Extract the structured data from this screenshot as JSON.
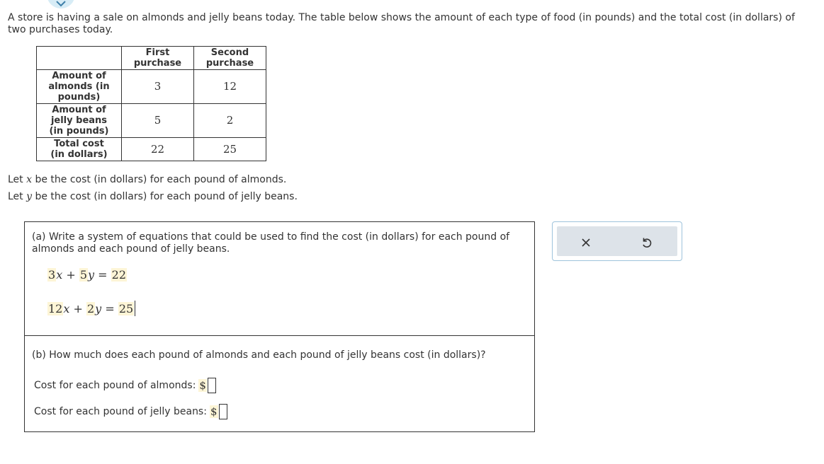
{
  "intro": "A store is having a sale on almonds and jelly beans today. The table below shows the amount of each type of food (in pounds) and the total cost (in dollars) of two purchases today.",
  "table": {
    "col_headers": [
      "First purchase",
      "Second purchase"
    ],
    "rows": [
      {
        "label": "Amount of almonds (in pounds)",
        "values": [
          "3",
          "12"
        ]
      },
      {
        "label": "Amount of jelly beans (in pounds)",
        "values": [
          "5",
          "2"
        ]
      },
      {
        "label": "Total cost (in dollars)",
        "values": [
          "22",
          "25"
        ]
      }
    ]
  },
  "let_x": {
    "prefix": "Let",
    "var": "x",
    "text": "be the cost (in dollars) for each pound of almonds."
  },
  "let_y": {
    "prefix": "Let",
    "var": "y",
    "text": "be the cost (in dollars) for each pound of jelly beans."
  },
  "part_a": {
    "question": "(a) Write a system of equations that could be used to find the cost (in dollars) for each pound of almonds and each pound of jelly beans.",
    "eq1": {
      "c1": "3",
      "v1": "x",
      "op": "+",
      "c2": "5",
      "v2": "y",
      "eqsign": "=",
      "rhs": "22"
    },
    "eq2": {
      "c1": "12",
      "v1": "x",
      "op": "+",
      "c2": "2",
      "v2": "y",
      "eqsign": "=",
      "rhs": "25"
    }
  },
  "part_b": {
    "question": "(b) How much does each pound of almonds and each pound of jelly beans cost (in dollars)?",
    "almonds_label": "Cost for each pound of almonds:",
    "jelly_label": "Cost for each pound of jelly beans:",
    "currency": "$",
    "almonds_value": "",
    "jelly_value": ""
  },
  "tools": {
    "clear_icon": "close-icon",
    "undo_icon": "undo-icon"
  },
  "colors": {
    "highlight": "#fdf5d6",
    "tool_bg": "#dde3e9",
    "tool_border": "#9ec3dc",
    "tab": "#d7ecf6",
    "accent": "#3d7fa8"
  }
}
